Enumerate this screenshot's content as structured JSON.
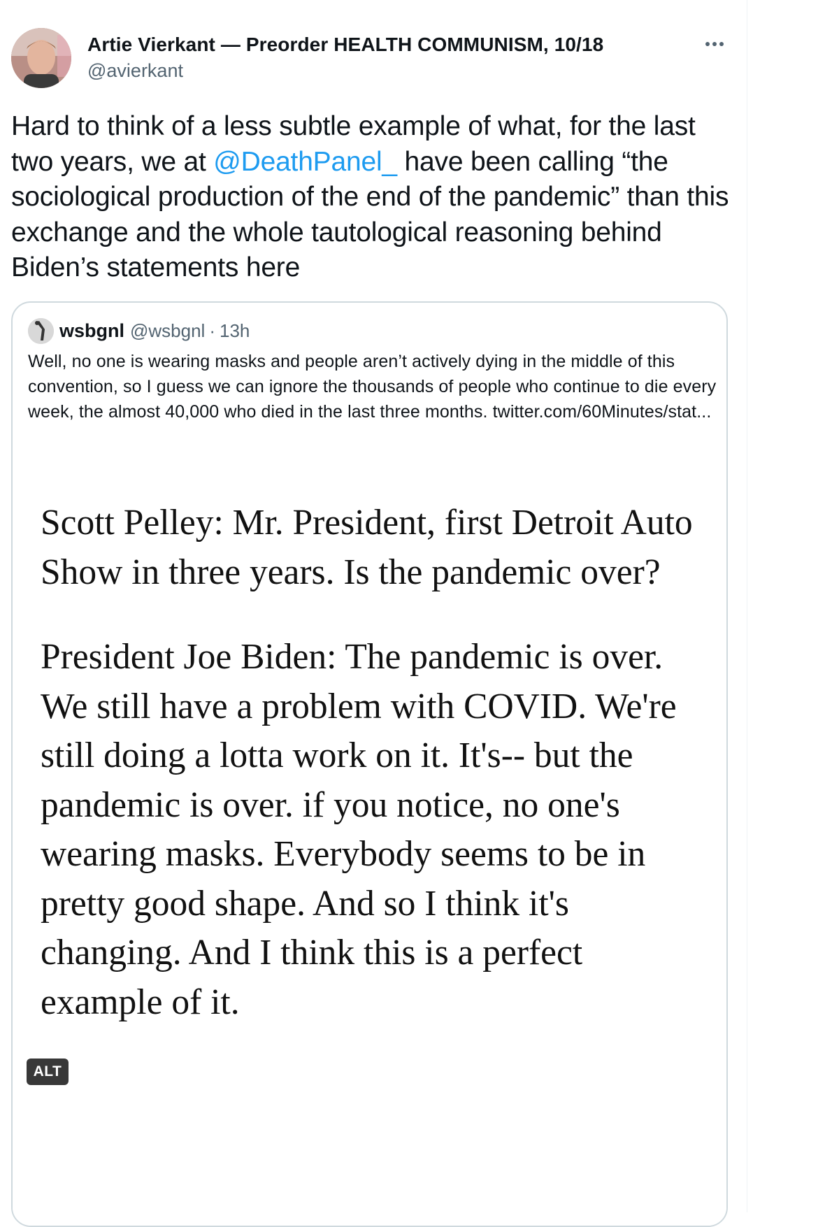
{
  "tweet": {
    "author_name": "Artie Vierkant — Preorder HEALTH COMMUNISM, 10/18",
    "author_handle": "@avierkant",
    "more_label": "···",
    "text_part1": "Hard to think of a less subtle example of what, for the last two years, we at ",
    "mention": "@DeathPanel_",
    "text_part2": " have been calling “the sociological production of the end of the pandemic” than this exchange and the whole tautological reasoning behind Biden’s statements here"
  },
  "quoted_tweet": {
    "author_name": "wsbgnl",
    "author_handle": "@wsbgnl",
    "separator": "·",
    "time": "13h",
    "text": "Well, no one is wearing masks and people aren’t actively dying in the middle of this convention, so I guess we can ignore the thousands of people who continue to die every week, the almost 40,000 who died in the last three months. ",
    "link": "twitter.com/60Minutes/stat...",
    "image_transcript": {
      "para1": "Scott Pelley: Mr. President, first Detroit Auto Show in three years. Is the pandemic over?",
      "para2": "President Joe Biden: The pandemic is over. We still have a problem with COVID. We're still doing a lotta work on it. It's-- but the pandemic is over. if you notice, no one's wearing masks. Everybody seems to be in pretty good shape. And so I think it's changing. And I think this is a perfect example of it."
    },
    "alt_label": "ALT"
  },
  "colors": {
    "link_blue": "#1d9bf0",
    "text_primary": "#0f1419",
    "text_secondary": "#536471",
    "border": "#cfd9de"
  }
}
